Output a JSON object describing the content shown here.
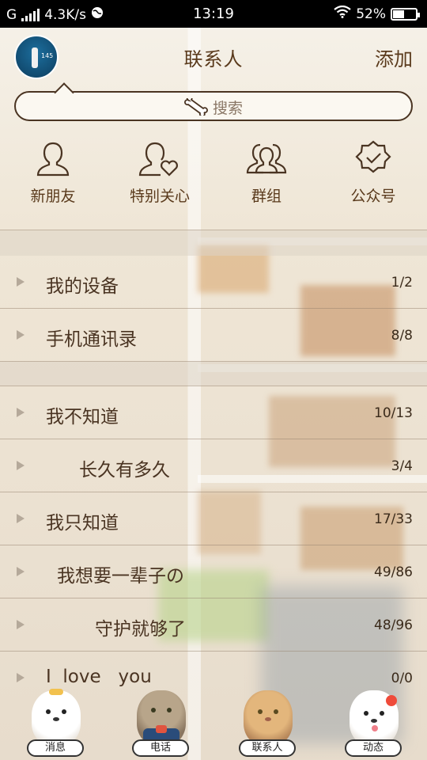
{
  "status_bar": {
    "carrier": "G",
    "speed": "4.3K/s",
    "time": "13:19",
    "battery": "52%",
    "battery_level": 0.52
  },
  "header": {
    "title": "联系人",
    "add_label": "添加",
    "avatar_text": "145"
  },
  "search": {
    "placeholder": "搜索",
    "icon": "bone-icon"
  },
  "quick_actions": [
    {
      "label": "新朋友",
      "icon": "person-icon"
    },
    {
      "label": "特别关心",
      "icon": "person-heart-icon"
    },
    {
      "label": "群组",
      "icon": "group-icon"
    },
    {
      "label": "公众号",
      "icon": "badge-check-icon"
    }
  ],
  "groups_top": [
    {
      "name": "我的设备",
      "count": "1/2"
    },
    {
      "name": "手机通讯录",
      "count": "8/8"
    }
  ],
  "groups": [
    {
      "name": "我不知道",
      "count": "10/13"
    },
    {
      "name": "长久有多久",
      "count": "3/4"
    },
    {
      "name": "我只知道",
      "count": "17/33"
    },
    {
      "name": "我想要一辈子の",
      "count": "49/86"
    },
    {
      "name": "守护就够了",
      "count": "48/96"
    },
    {
      "name": "I  love   you",
      "count": "0/0"
    }
  ],
  "bottom_nav": [
    {
      "label": "消息"
    },
    {
      "label": "电话"
    },
    {
      "label": "联系人"
    },
    {
      "label": "动态"
    }
  ],
  "colors": {
    "text_brown": "#5a3a1c",
    "badge_red": "#ef4b3a",
    "status_bg": "#000000"
  }
}
